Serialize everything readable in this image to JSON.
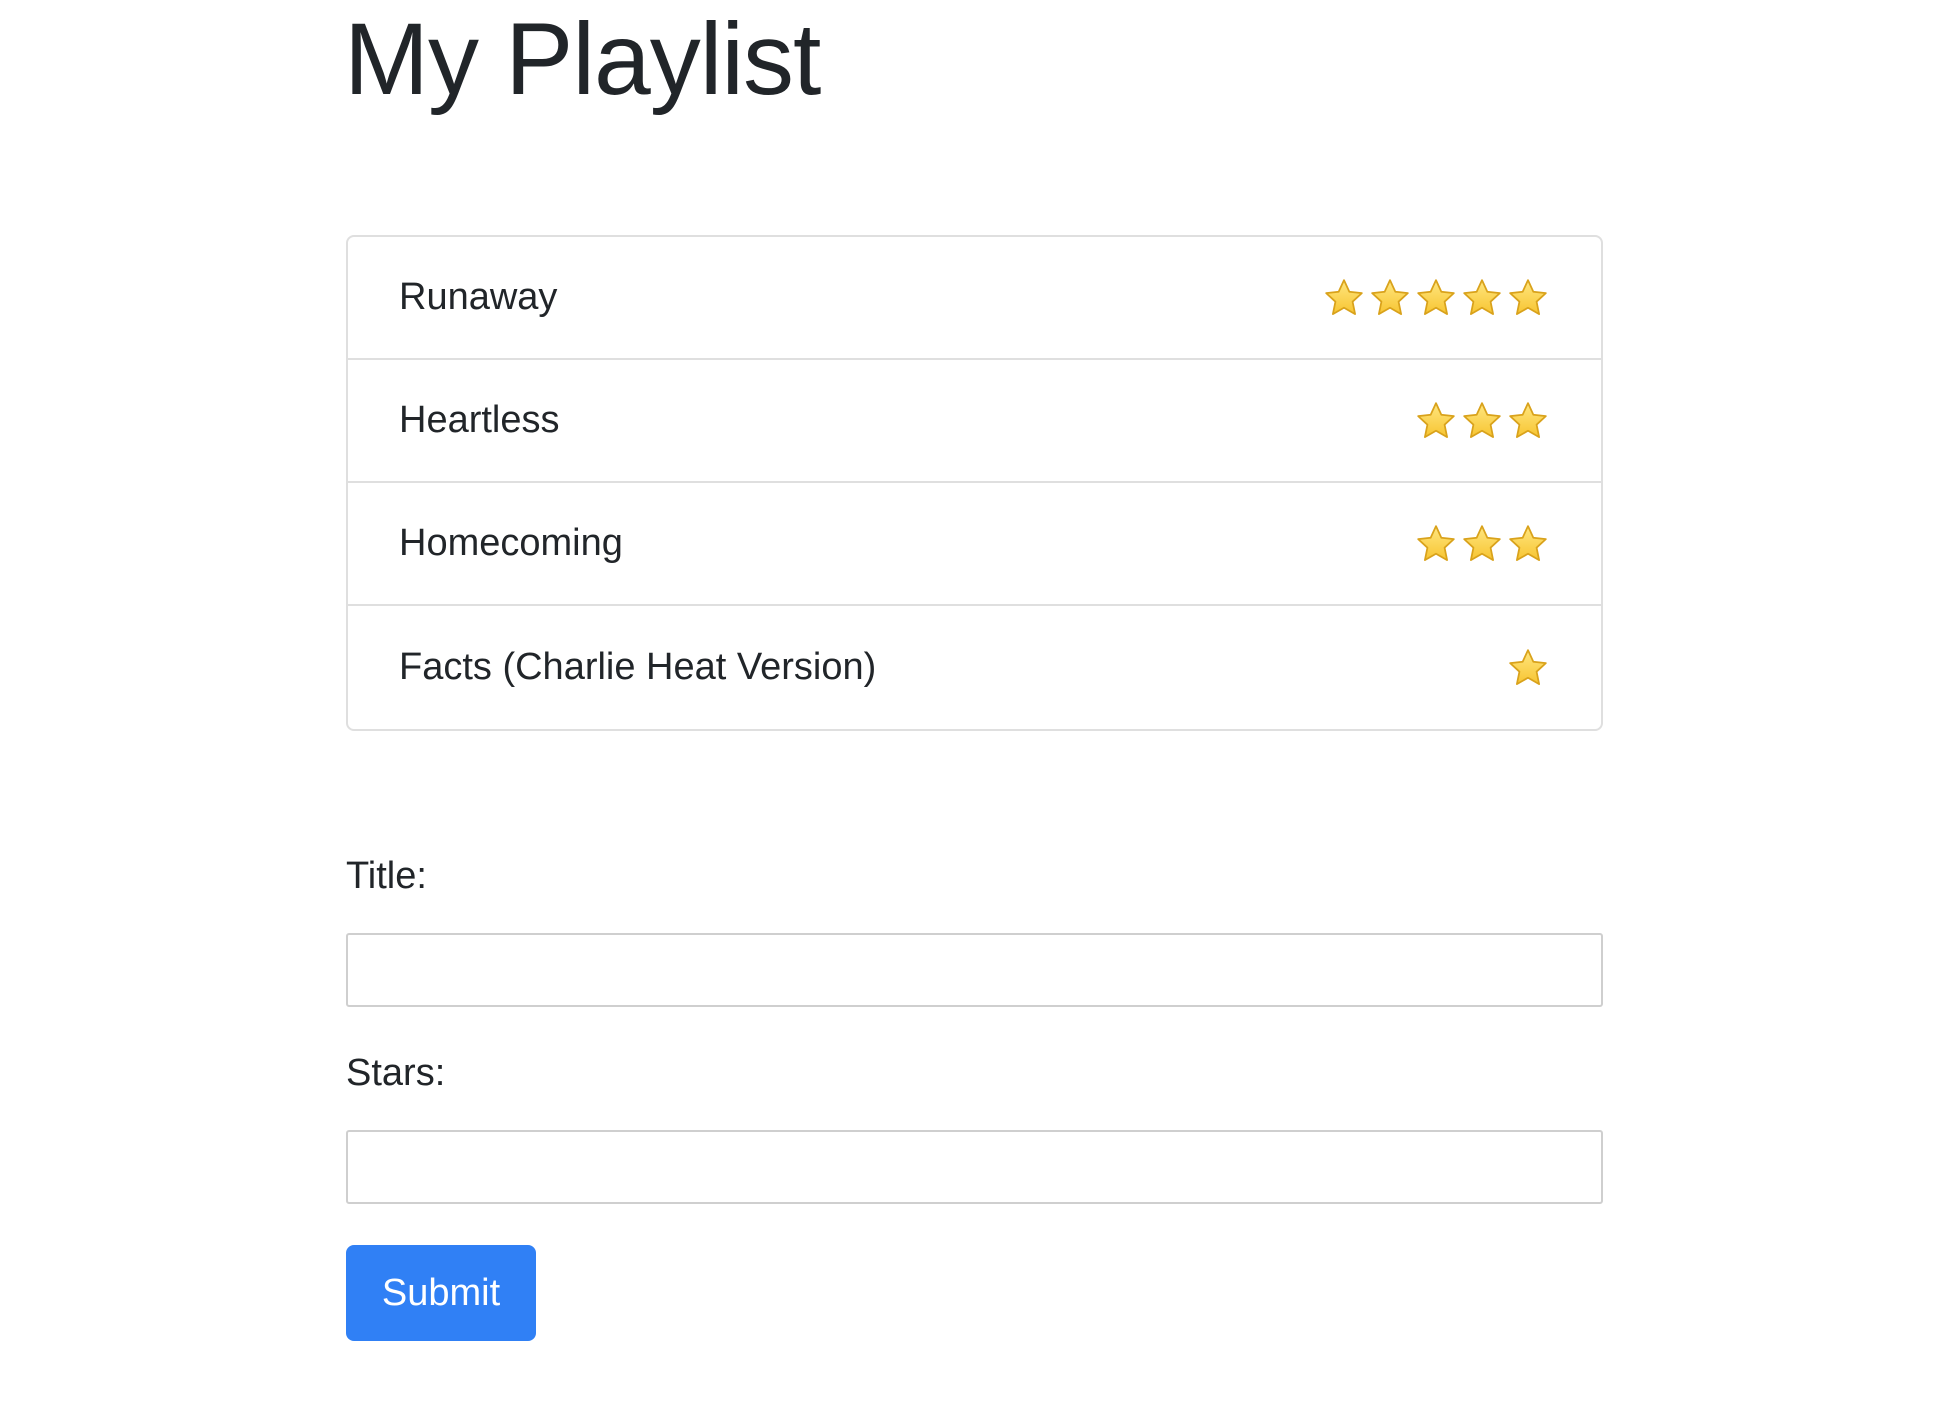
{
  "page": {
    "title": "My Playlist"
  },
  "playlist": {
    "songs": [
      {
        "title": "Runaway",
        "stars": 5
      },
      {
        "title": "Heartless",
        "stars": 3
      },
      {
        "title": "Homecoming",
        "stars": 3
      },
      {
        "title": "Facts (Charlie Heat Version)",
        "stars": 1
      }
    ],
    "star_icon": "star-icon",
    "star_color": "#f7c531"
  },
  "form": {
    "title_label": "Title:",
    "title_value": "",
    "stars_label": "Stars:",
    "stars_value": "",
    "submit_label": "Submit",
    "submit_color": "#3080f5"
  }
}
